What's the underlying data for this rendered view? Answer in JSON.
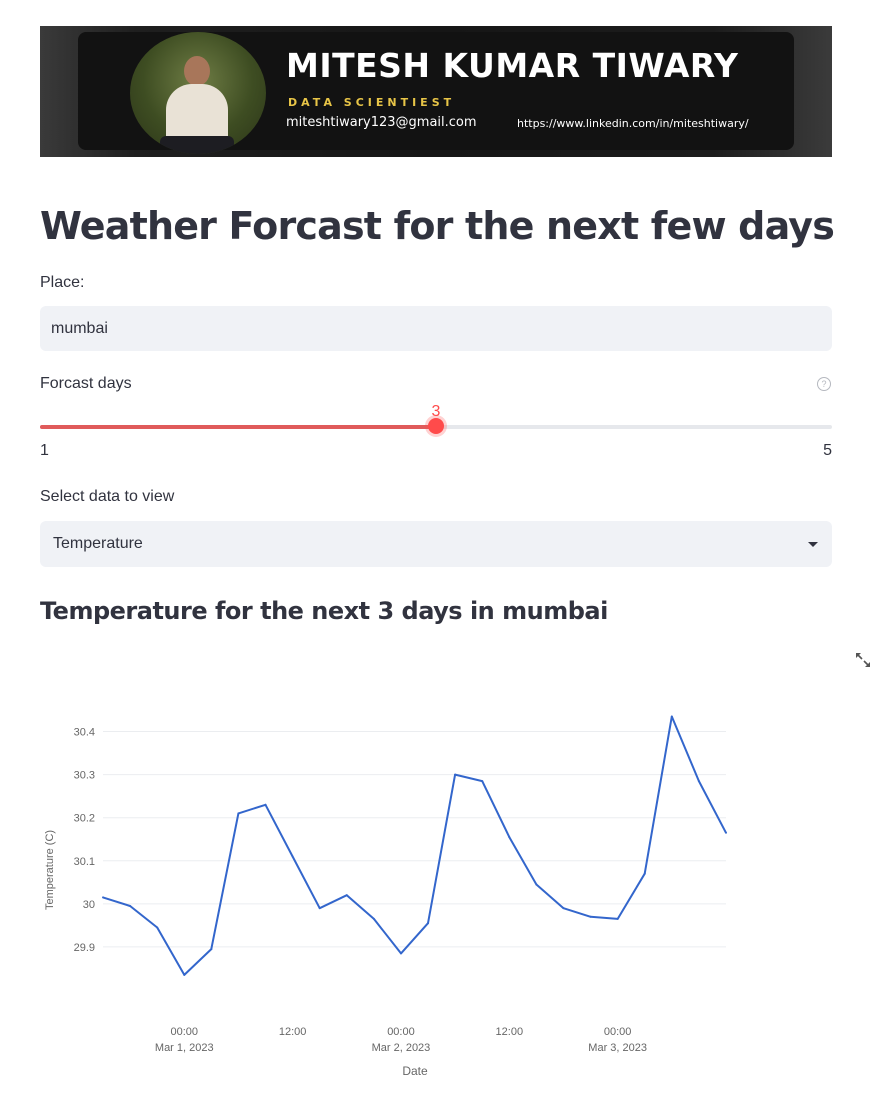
{
  "banner": {
    "name": "MITESH KUMAR TIWARY",
    "role": "DATA SCIENTIEST",
    "email": "miteshtiwary123@gmail.com",
    "linkedin": "https://www.linkedin.com/in/miteshtiwary/"
  },
  "page": {
    "title": "Weather Forcast for the next few days"
  },
  "place": {
    "label": "Place:",
    "value": "mumbai"
  },
  "forecast_days": {
    "label": "Forcast days",
    "help_icon": "question-circle-icon",
    "value": 3,
    "min": 1,
    "max": 5,
    "value_text": "3",
    "min_text": "1",
    "max_text": "5",
    "accent": "#ff4b4b"
  },
  "data_select": {
    "label": "Select data to view",
    "selected": "Temperature"
  },
  "subheader": "Temperature for the next 3 days in mumbai",
  "toolbar": {
    "expand_icon": "fullscreen-expand-icon"
  },
  "chart_data": {
    "type": "line",
    "xlabel": "Date",
    "ylabel": "Temperature (C)",
    "ylim": [
      29.8,
      30.45
    ],
    "yticks": [
      29.9,
      30,
      30.1,
      30.2,
      30.3,
      30.4
    ],
    "ytick_labels": [
      "29.9",
      "30",
      "30.1",
      "30.2",
      "30.3",
      "30.4"
    ],
    "grid": true,
    "line_color": "#3366cc",
    "xticks": [
      {
        "x": "2023-03-01 00:00",
        "line1": "00:00",
        "line2": "Mar 1, 2023"
      },
      {
        "x": "2023-03-01 12:00",
        "line1": "12:00",
        "line2": ""
      },
      {
        "x": "2023-03-02 00:00",
        "line1": "00:00",
        "line2": "Mar 2, 2023"
      },
      {
        "x": "2023-03-02 12:00",
        "line1": "12:00",
        "line2": ""
      },
      {
        "x": "2023-03-03 00:00",
        "line1": "00:00",
        "line2": "Mar 3, 2023"
      }
    ],
    "xlim": [
      "2023-02-28 15:00",
      "2023-03-03 12:00"
    ],
    "series": [
      {
        "x": [
          "2023-02-28 15:00",
          "2023-02-28 18:00",
          "2023-02-28 21:00",
          "2023-03-01 00:00",
          "2023-03-01 03:00",
          "2023-03-01 06:00",
          "2023-03-01 09:00",
          "2023-03-01 12:00",
          "2023-03-01 15:00",
          "2023-03-01 18:00",
          "2023-03-01 21:00",
          "2023-03-02 00:00",
          "2023-03-02 03:00",
          "2023-03-02 06:00",
          "2023-03-02 09:00",
          "2023-03-02 12:00",
          "2023-03-02 15:00",
          "2023-03-02 18:00",
          "2023-03-02 21:00",
          "2023-03-03 00:00",
          "2023-03-03 03:00",
          "2023-03-03 06:00",
          "2023-03-03 09:00",
          "2023-03-03 12:00"
        ],
        "values": [
          30.015,
          29.995,
          29.945,
          29.835,
          29.895,
          30.21,
          30.23,
          30.11,
          29.99,
          30.02,
          29.965,
          29.885,
          29.955,
          30.3,
          30.285,
          30.155,
          30.045,
          29.99,
          29.97,
          29.965,
          30.07,
          30.435,
          30.285,
          30.165
        ]
      }
    ]
  }
}
